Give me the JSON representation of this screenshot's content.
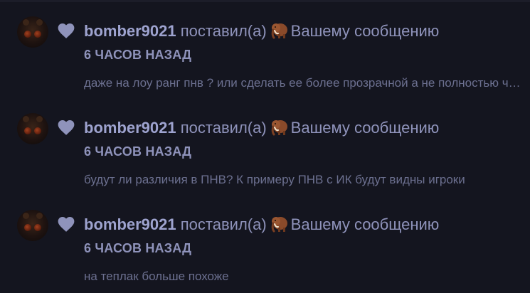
{
  "notifications": [
    {
      "user": "bomber9021",
      "action": "поставил(а)",
      "reaction_icon": "mammoth-icon",
      "target": "Вашему сообщению",
      "time": "6 ЧАСОВ НАЗАД",
      "snippet": "даже на лоу ранг пнв ? или сделать ее более прозрачной а не полностью черной"
    },
    {
      "user": "bomber9021",
      "action": "поставил(а)",
      "reaction_icon": "mammoth-icon",
      "target": "Вашему сообщению",
      "time": "6 ЧАСОВ НАЗАД",
      "snippet": "будут ли различия в ПНВ? К примеру ПНВ с ИК будут видны игроки"
    },
    {
      "user": "bomber9021",
      "action": "поставил(а)",
      "reaction_icon": "mammoth-icon",
      "target": "Вашему сообщению",
      "time": "6 ЧАСОВ НАЗАД",
      "snippet": "на теплак больше похоже"
    }
  ],
  "colors": {
    "background": "#14151f",
    "accent": "#9ea3cf",
    "text": "#8f93bb",
    "muted": "#6c7090"
  }
}
